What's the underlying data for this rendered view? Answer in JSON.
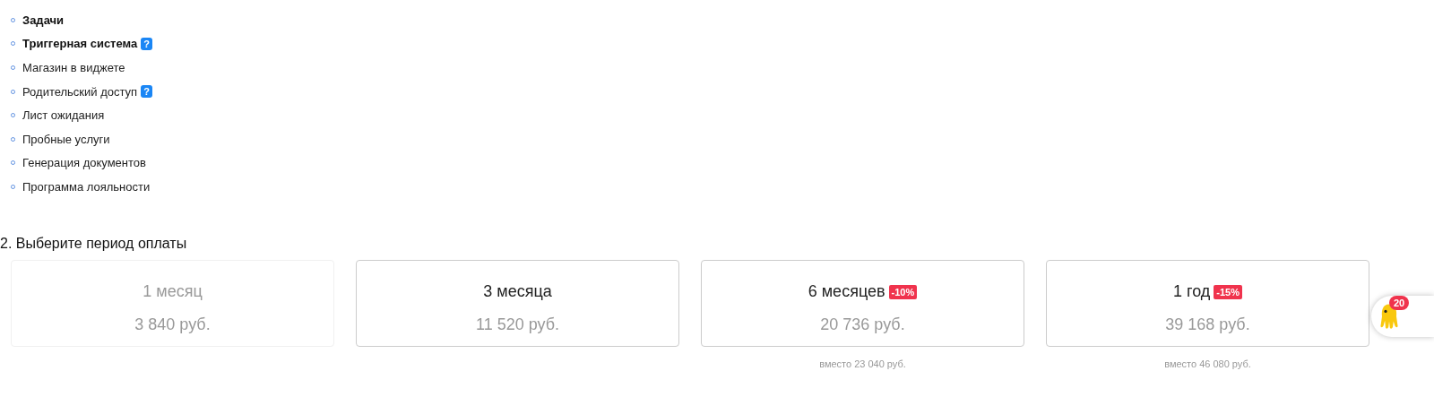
{
  "features": [
    {
      "label": "Задачи",
      "bold": true,
      "help": false
    },
    {
      "label": "Триггерная система",
      "bold": true,
      "help": true
    },
    {
      "label": "Магазин в виджете",
      "bold": false,
      "help": false
    },
    {
      "label": "Родительский доступ",
      "bold": false,
      "help": true
    },
    {
      "label": "Лист ожидания",
      "bold": false,
      "help": false
    },
    {
      "label": "Пробные услуги",
      "bold": false,
      "help": false
    },
    {
      "label": "Генерация документов",
      "bold": false,
      "help": false
    },
    {
      "label": "Программа лояльности",
      "bold": false,
      "help": false
    }
  ],
  "help_icon": "?",
  "period_heading": "2. Выберите период оплаты",
  "periods": [
    {
      "title": "1 месяц",
      "price": "3 840 руб.",
      "disabled": true
    },
    {
      "title": "3 месяца",
      "price": "11 520 руб.",
      "disabled": false
    },
    {
      "title": "6 месяцев",
      "discount": "-10%",
      "price": "20 736 руб.",
      "old_price": "вместо 23 040 руб.",
      "disabled": false
    },
    {
      "title": "1 год",
      "discount": "-15%",
      "price": "39 168 руб.",
      "old_price": "вместо 46 080 руб.",
      "disabled": false
    }
  ],
  "chat_widget": {
    "badge": "20"
  }
}
